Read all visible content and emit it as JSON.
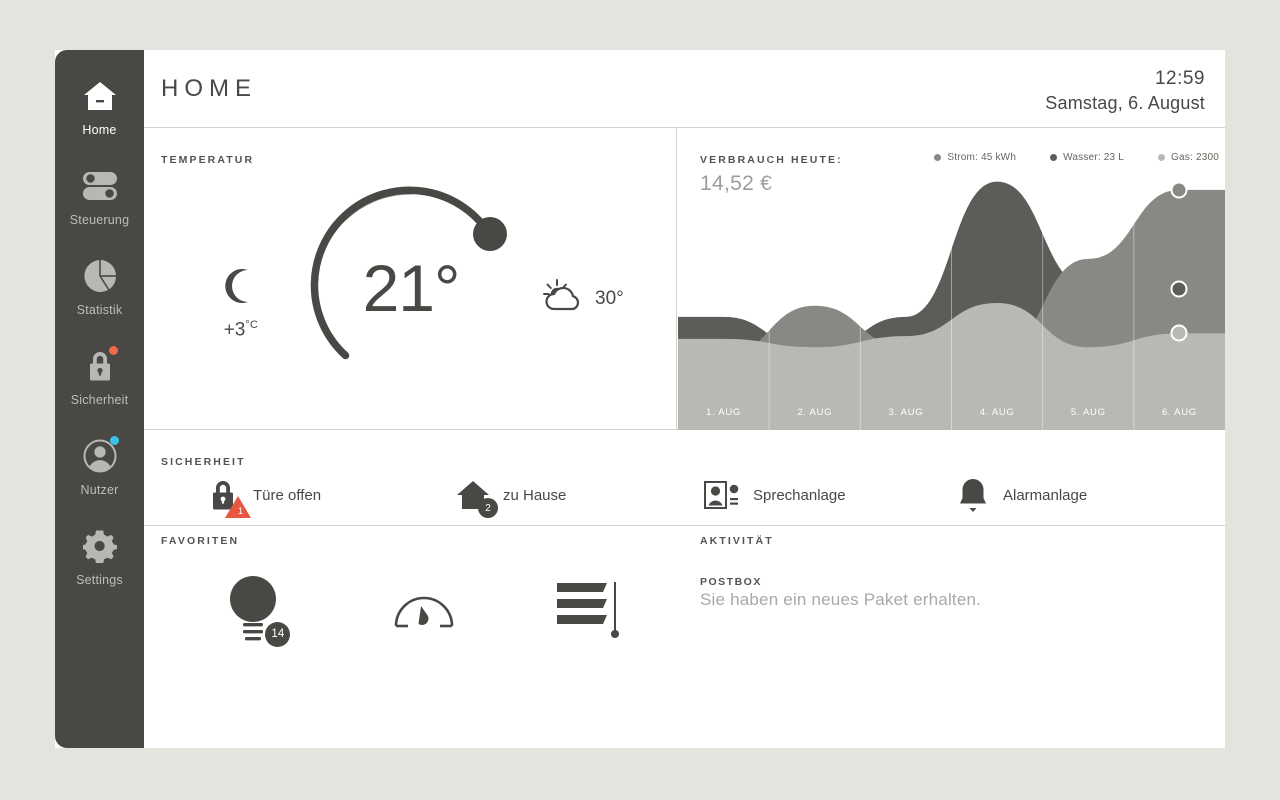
{
  "sidebar": {
    "items": [
      {
        "label": "Home",
        "icon": "house-icon",
        "active": true,
        "badge": null
      },
      {
        "label": "Steuerung",
        "icon": "toggles-icon",
        "active": false,
        "badge": null
      },
      {
        "label": "Statistik",
        "icon": "pie-chart-icon",
        "active": false,
        "badge": null
      },
      {
        "label": "Sicherheit",
        "icon": "lock-icon",
        "active": false,
        "badge": "#ef6a4a"
      },
      {
        "label": "Nutzer",
        "icon": "user-icon",
        "active": false,
        "badge": "#35c3e8"
      },
      {
        "label": "Settings",
        "icon": "gear-icon",
        "active": false,
        "badge": null
      }
    ]
  },
  "header": {
    "title": "HOME",
    "time": "12:59",
    "date": "Samstag, 6. August"
  },
  "temperature": {
    "label": "TEMPERATUR",
    "current": "21°",
    "night_icon": "moon-icon",
    "night_temp": "+3",
    "night_unit": "°C",
    "day_icon": "sun-cloud-icon",
    "day_temp": "30°",
    "dial_percent": 72
  },
  "consumption": {
    "label": "VERBRAUCH HEUTE:",
    "total": "14,52 €",
    "legend": [
      {
        "name": "Strom: 45 kWh",
        "color": "#8a8884"
      },
      {
        "name": "Wasser: 23 L",
        "color": "#5e5c58"
      },
      {
        "name": "Gas: 2300",
        "color": "#b9b8b4"
      }
    ]
  },
  "chart_data": {
    "type": "area",
    "title": "VERBRAUCH HEUTE:",
    "xlabel": "",
    "ylabel": "",
    "grid": true,
    "legend_position": "top-right",
    "categories": [
      "1. AUG",
      "2. AUG",
      "3. AUG",
      "4. AUG",
      "5. AUG",
      "6. AUG"
    ],
    "x": [
      1,
      2,
      3,
      4,
      5,
      6
    ],
    "ylim": [
      0,
      100
    ],
    "series": [
      {
        "name": "Gas: 2300",
        "color": "#b9b8b4",
        "values": [
          33,
          30,
          34,
          46,
          30,
          35
        ],
        "marker_value": 35
      },
      {
        "name": "Wasser: 23 L",
        "color": "#5e5c58",
        "values": [
          41,
          28,
          41,
          90,
          52,
          51
        ],
        "marker_value": 51
      },
      {
        "name": "Strom: 45 kWh",
        "color": "#8a8884",
        "values": [
          27,
          45,
          30,
          28,
          62,
          87
        ],
        "marker_value": 87
      }
    ]
  },
  "security": {
    "label": "SICHERHEIT",
    "items": [
      {
        "label": "Türe offen",
        "icon": "lock-icon",
        "badge": "1",
        "badge_type": "triangle"
      },
      {
        "label": "zu Hause",
        "icon": "house-icon",
        "badge": "2",
        "badge_type": "circle"
      },
      {
        "label": "Sprechanlage",
        "icon": "intercom-icon",
        "badge": null,
        "badge_type": null
      },
      {
        "label": "Alarmanlage",
        "icon": "bell-icon",
        "badge": null,
        "badge_type": null
      }
    ]
  },
  "favorites": {
    "label": "FAVORITEN",
    "items": [
      {
        "icon": "lightbulb-icon",
        "badge": "14"
      },
      {
        "icon": "gauge-icon",
        "badge": null
      },
      {
        "icon": "blinds-icon",
        "badge": null
      }
    ]
  },
  "activity": {
    "label": "AKTIVITÄT",
    "entry_title": "POSTBOX",
    "entry_text": "Sie haben ein neues Paket erhalten."
  },
  "colors": {
    "sidebar": "#4a4844",
    "accent_alert": "#e8573f",
    "accent_user": "#35c3e8",
    "frame": "#e4e4df"
  }
}
